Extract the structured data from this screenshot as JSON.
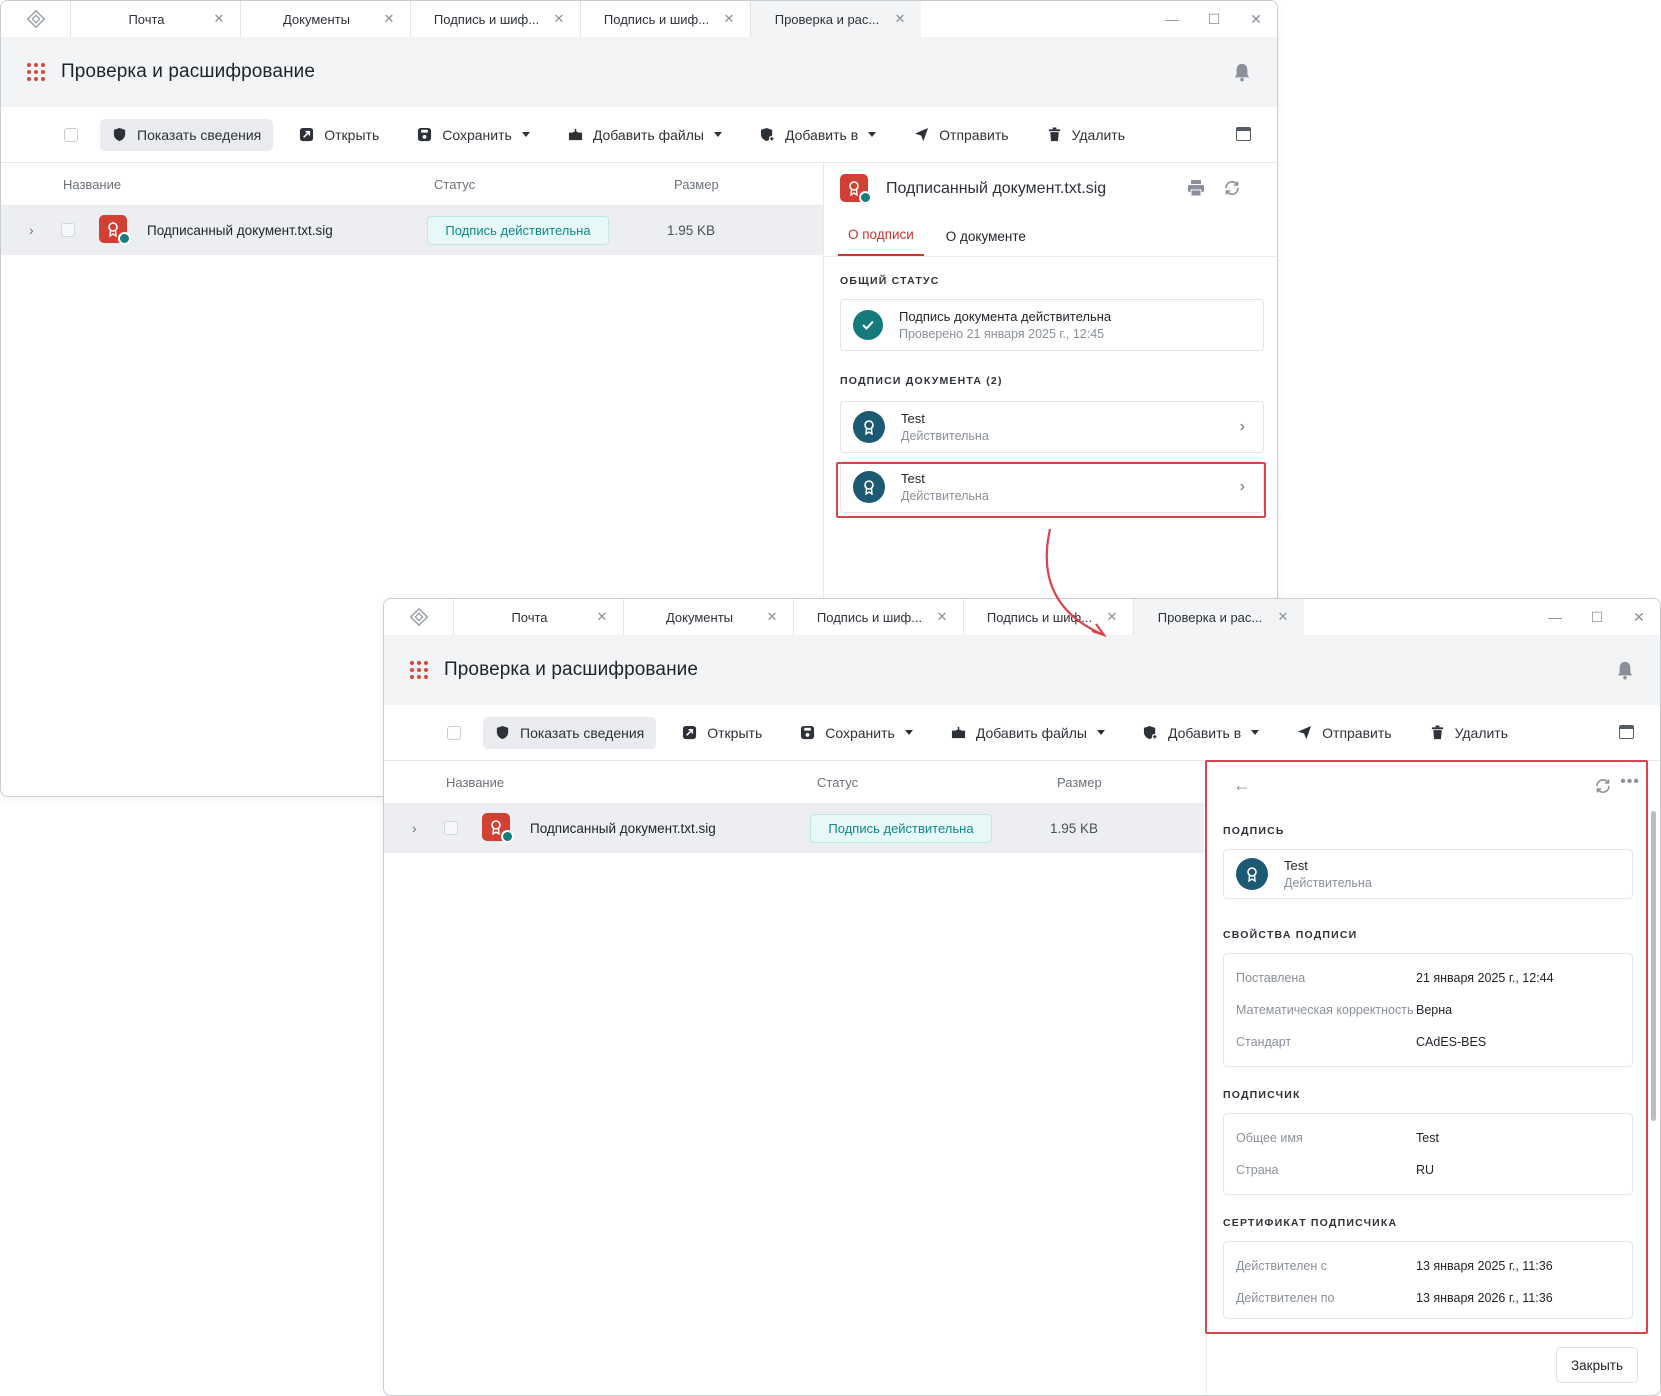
{
  "app": {
    "tabs": [
      {
        "label": "Почта"
      },
      {
        "label": "Документы"
      },
      {
        "label": "Подпись и шиф..."
      },
      {
        "label": "Подпись и шиф..."
      },
      {
        "label": "Проверка и рас..."
      }
    ],
    "window_controls": {
      "minimize": "—",
      "maximize": "☐",
      "close": "✕"
    },
    "page_title": "Проверка и расшифрование"
  },
  "toolbar": {
    "show_details": "Показать сведения",
    "open": "Открыть",
    "save": "Сохранить",
    "add_files": "Добавить файлы",
    "add_to": "Добавить в",
    "send": "Отправить",
    "delete": "Удалить"
  },
  "list": {
    "col_name": "Название",
    "col_status": "Статус",
    "col_size": "Размер",
    "rows": [
      {
        "name": "Подписанный документ.txt.sig",
        "status": "Подпись действительна",
        "size": "1.95 KB"
      }
    ]
  },
  "details": {
    "title": "Подписанный документ.txt.sig",
    "tab_signature": "О подписи",
    "tab_document": "О документе",
    "overall_status_label": "ОБЩИЙ СТАТУС",
    "overall_status": "Подпись документа действительна",
    "checked_at": "Проверено 21 января 2025 г., 12:45",
    "signatures_label": "ПОДПИСИ ДОКУМЕНТА (2)",
    "signatures": [
      {
        "name": "Test",
        "status": "Действительна"
      },
      {
        "name": "Test",
        "status": "Действительна"
      }
    ]
  },
  "signature_view": {
    "signature_label": "ПОДПИСЬ",
    "signer_name": "Test",
    "signer_status": "Действительна",
    "props_label": "СВОЙСТВА ПОДПИСИ",
    "props": [
      {
        "k": "Поставлена",
        "v": "21 января 2025 г., 12:44"
      },
      {
        "k": "Математическая корректность",
        "v": "Верна"
      },
      {
        "k": "Стандарт",
        "v": "CAdES-BES"
      }
    ],
    "signer_label": "ПОДПИСЧИК",
    "signer": [
      {
        "k": "Общее имя",
        "v": "Test"
      },
      {
        "k": "Страна",
        "v": "RU"
      }
    ],
    "cert_label": "СЕРТИФИКАТ ПОДПИСЧИКА",
    "cert": [
      {
        "k": "Действителен с",
        "v": "13 января 2025 г., 11:36"
      },
      {
        "k": "Действителен по",
        "v": "13 января 2026 г., 11:36"
      }
    ],
    "close": "Закрыть"
  },
  "colors": {
    "accent": "#d23f33",
    "valid": "#12878a",
    "highlight": "#d9434b"
  }
}
